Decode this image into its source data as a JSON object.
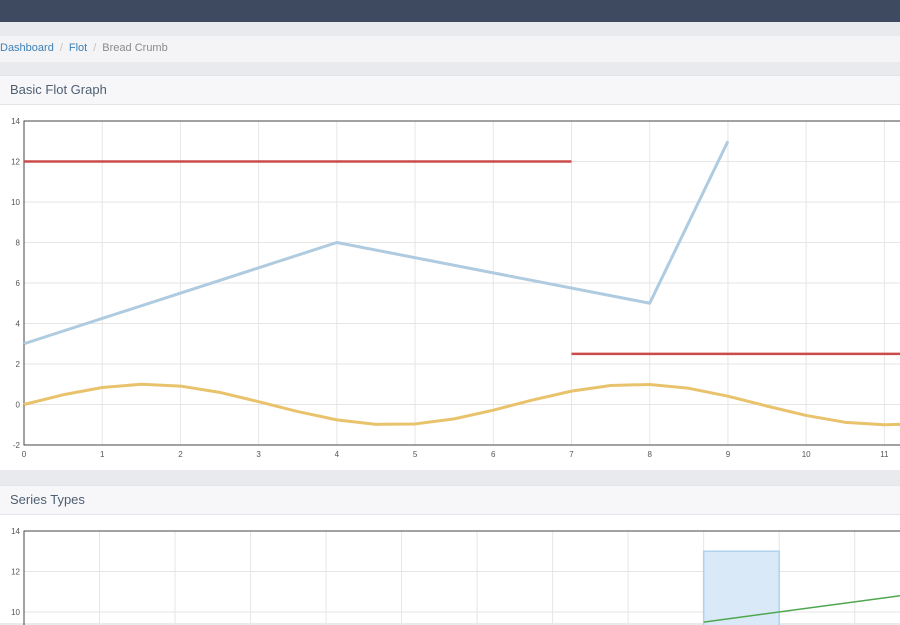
{
  "breadcrumb": [
    {
      "label": "Dashboard"
    },
    {
      "label": "Flot"
    },
    {
      "label": "Bread Crumb"
    }
  ],
  "panels": [
    {
      "title": "Basic Flot Graph"
    },
    {
      "title": "Series Types"
    }
  ],
  "colors": {
    "topbar": "#3d4a5f",
    "link": "#3c80b5",
    "red_series": "#cb4b4b",
    "blue_series": "#afcbe0",
    "yellow_series": "#e9c26c",
    "green_series": "#4da74d",
    "bar_fill": "#d9e9f7",
    "bar_stroke": "#afd2ef"
  },
  "chart_data": [
    {
      "type": "line",
      "xlim": [
        0,
        11.2
      ],
      "ylim": [
        -2,
        14
      ],
      "x_ticks": [
        0,
        1,
        2,
        3,
        4,
        5,
        6,
        7,
        8,
        9,
        10,
        11
      ],
      "y_ticks": [
        -2,
        0,
        2,
        4,
        6,
        8,
        10,
        12,
        14
      ],
      "grid": true,
      "series": [
        {
          "color": "#cb4b4b",
          "segments": [
            [
              [
                0,
                12
              ],
              [
                7,
                12
              ]
            ],
            [
              [
                7,
                2.5
              ],
              [
                11.2,
                2.5
              ]
            ]
          ]
        },
        {
          "color": "#afcbe0",
          "points": [
            [
              0,
              3
            ],
            [
              4,
              8
            ],
            [
              8,
              5
            ],
            [
              9,
              13
            ]
          ]
        },
        {
          "color": "#e9c26c",
          "points": [
            [
              0,
              0
            ],
            [
              0.5,
              0.48
            ],
            [
              1,
              0.84
            ],
            [
              1.5,
              1.0
            ],
            [
              2,
              0.91
            ],
            [
              2.5,
              0.6
            ],
            [
              3,
              0.14
            ],
            [
              3.5,
              -0.35
            ],
            [
              4,
              -0.76
            ],
            [
              4.5,
              -0.98
            ],
            [
              5,
              -0.96
            ],
            [
              5.5,
              -0.71
            ],
            [
              6,
              -0.28
            ],
            [
              6.5,
              0.22
            ],
            [
              7,
              0.66
            ],
            [
              7.5,
              0.94
            ],
            [
              8,
              0.99
            ],
            [
              8.5,
              0.8
            ],
            [
              9,
              0.41
            ],
            [
              9.5,
              -0.08
            ],
            [
              10,
              -0.54
            ],
            [
              10.5,
              -0.88
            ],
            [
              11,
              -1.0
            ],
            [
              11.2,
              -0.98
            ]
          ]
        }
      ]
    },
    {
      "type": "bar",
      "xlim": [
        0,
        11.6
      ],
      "ylim": [
        -2,
        14
      ],
      "y_ticks": [
        10,
        12,
        14
      ],
      "grid": true,
      "bars": [
        {
          "x": 9,
          "width": 1,
          "value": 13
        }
      ],
      "series": [
        {
          "color": "#4da74d",
          "points": [
            [
              9,
              9.5
            ],
            [
              11.6,
              10.8
            ]
          ]
        }
      ]
    }
  ]
}
